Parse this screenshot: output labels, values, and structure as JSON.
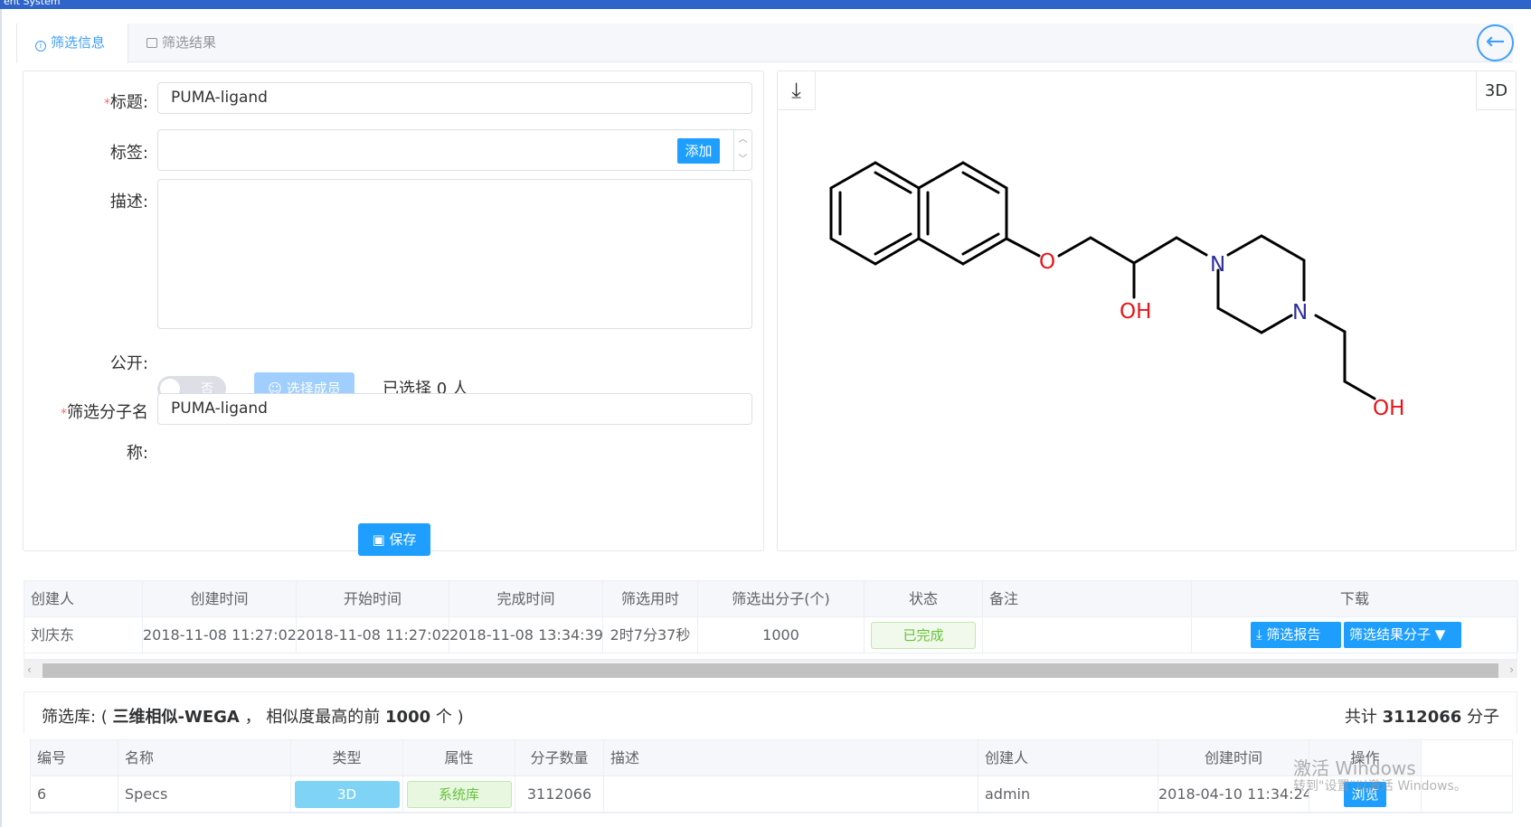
{
  "window": {
    "title": "ent System"
  },
  "tabs": [
    {
      "label": "筛选信息",
      "active": true
    },
    {
      "label": "筛选结果",
      "active": false
    }
  ],
  "form": {
    "title_label": "标题:",
    "title_value": "PUMA-ligand",
    "tags_label": "标签:",
    "tags_add": "添加",
    "desc_label": "描述:",
    "desc_value": "",
    "public_label": "公开:",
    "public_value": "否",
    "select_members": "选择成员",
    "selected_count": "已选择 0 人",
    "molname_label_line1": "筛选分子名",
    "molname_label_line2": "称:",
    "molname_value": "PUMA-ligand",
    "required_mark": "*",
    "save_label": "保存"
  },
  "structure": {
    "btn_3d": "3D",
    "atom_labels": {
      "o1": "O",
      "oh1": "OH",
      "n1": "N",
      "n2": "N",
      "oh2": "OH"
    }
  },
  "task_table": {
    "headers": [
      "创建人",
      "创建时间",
      "开始时间",
      "完成时间",
      "筛选用时",
      "筛选出分子(个)",
      "状态",
      "备注",
      "下载"
    ],
    "row": {
      "creator": "刘庆东",
      "created": "2018-11-08 11:27:02",
      "started": "2018-11-08 11:27:02",
      "finished": "2018-11-08 13:34:39",
      "duration": "2时7分37秒",
      "count": "1000",
      "status": "已完成",
      "note": "",
      "report_btn": "筛选报告",
      "result_btn": "筛选结果分子"
    }
  },
  "library_bar": {
    "prefix": "筛选库: ( ",
    "lib_name": "三维相似-WEGA",
    "middle": " ， 相似度最高的前 ",
    "top_n": "1000",
    "suffix": " 个 )",
    "total_prefix": "共计 ",
    "total": "3112066",
    "total_suffix": " 分子"
  },
  "lib_table": {
    "headers": [
      "编号",
      "名称",
      "类型",
      "属性",
      "分子数量",
      "描述",
      "创建人",
      "创建时间",
      "操作"
    ],
    "rows": [
      {
        "id": "6",
        "name": "Specs",
        "type": "3D",
        "attr": "系统库",
        "count": "3112066",
        "desc": "",
        "creator": "admin",
        "created": "2018-04-10 11:34:24",
        "action": "浏览"
      }
    ]
  },
  "watermark": {
    "line1": "激活 Windows",
    "line2": "转到\"设置\"以激活 Windows。"
  }
}
